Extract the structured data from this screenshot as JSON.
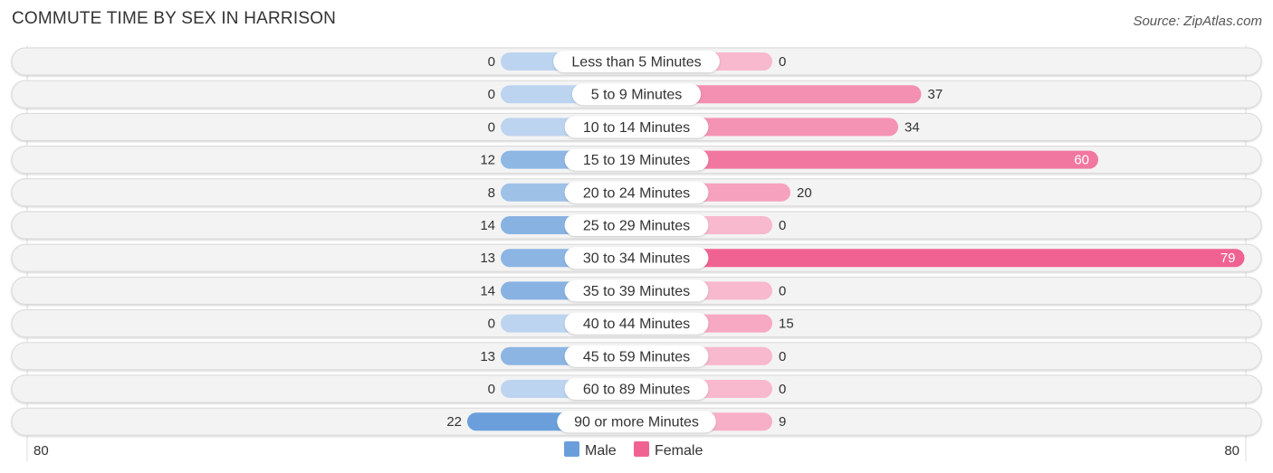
{
  "title": "COMMUTE TIME BY SEX IN HARRISON",
  "source": "Source: ZipAtlas.com",
  "chart_data": {
    "type": "bar",
    "orientation": "horizontal-diverging",
    "title": "COMMUTE TIME BY SEX IN HARRISON",
    "categories": [
      "Less than 5 Minutes",
      "5 to 9 Minutes",
      "10 to 14 Minutes",
      "15 to 19 Minutes",
      "20 to 24 Minutes",
      "25 to 29 Minutes",
      "30 to 34 Minutes",
      "35 to 39 Minutes",
      "40 to 44 Minutes",
      "45 to 59 Minutes",
      "60 to 89 Minutes",
      "90 or more Minutes"
    ],
    "series": [
      {
        "name": "Male",
        "color": "#6a9fdb",
        "values": [
          0,
          0,
          0,
          12,
          8,
          14,
          13,
          14,
          0,
          13,
          0,
          22
        ]
      },
      {
        "name": "Female",
        "color": "#f06292",
        "values": [
          0,
          37,
          34,
          60,
          20,
          0,
          79,
          0,
          15,
          0,
          0,
          9
        ]
      }
    ],
    "axis_min_label": "80",
    "axis_max_label": "80",
    "xlim": [
      -80,
      80
    ],
    "legend": {
      "position": "bottom-center",
      "items": [
        "Male",
        "Female"
      ]
    },
    "grid": false
  }
}
